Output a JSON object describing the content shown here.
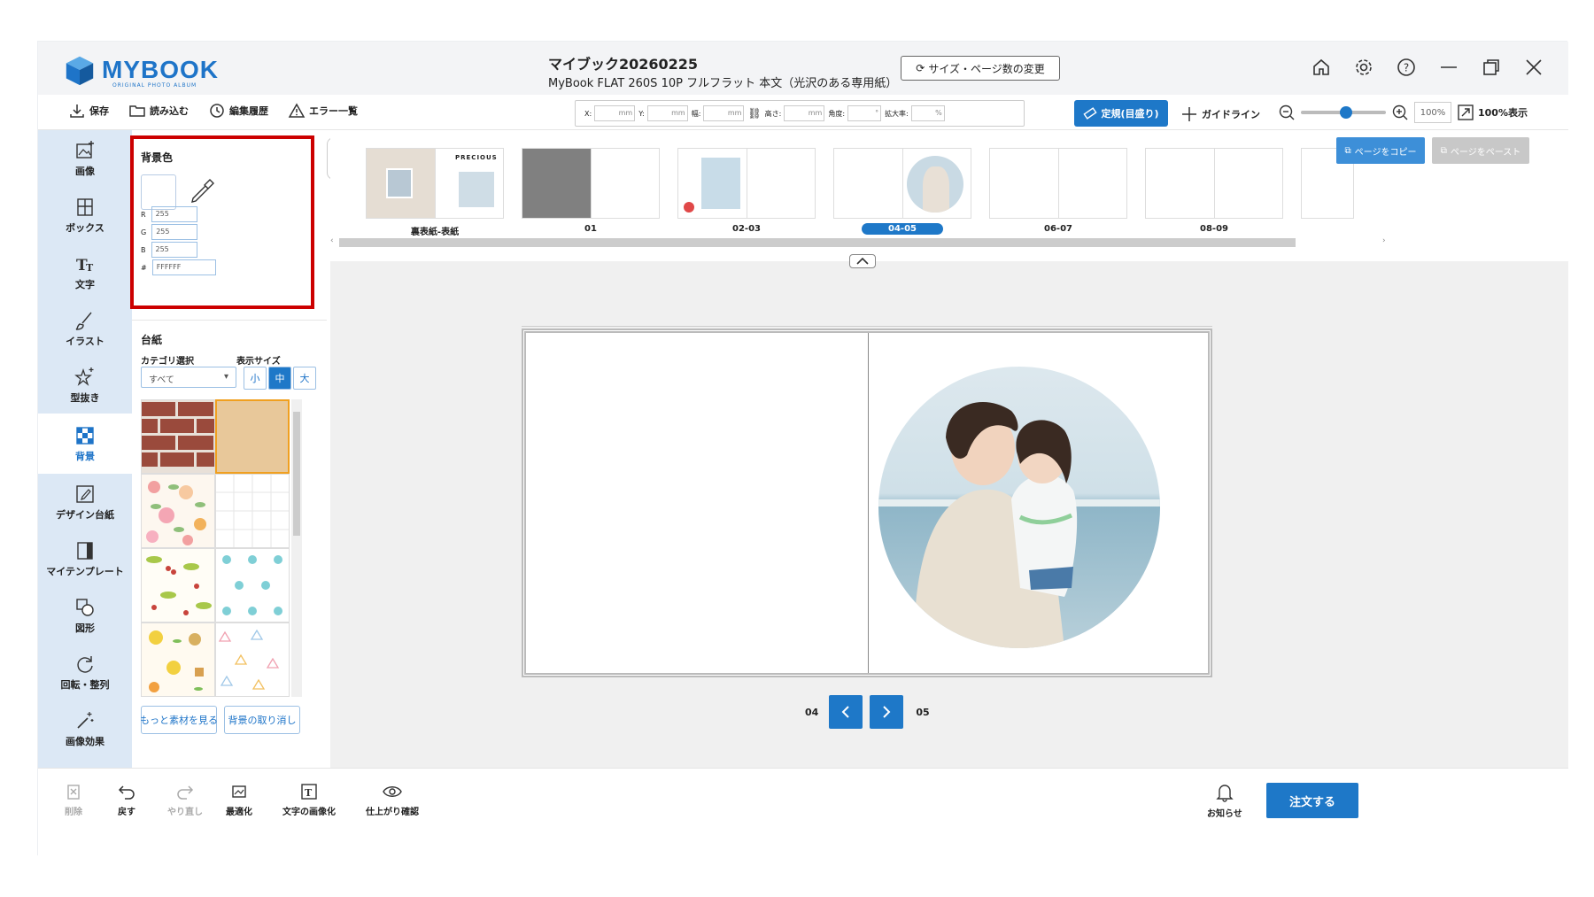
{
  "app": {
    "logo": "MYBOOK",
    "logo_sub": "ORIGINAL PHOTO ALBUM"
  },
  "document": {
    "title": "マイブック20260225",
    "subtitle": "MyBook FLAT 260S 10P フルフラット 本文（光沢のある専用紙）"
  },
  "header": {
    "size_button": "サイズ・ページ数の変更"
  },
  "toolbar": {
    "save": "保存",
    "load": "読み込む",
    "history": "編集履歴",
    "errors": "エラー一覧",
    "coords": [
      {
        "label": "X:",
        "unit": "mm"
      },
      {
        "label": "Y:",
        "unit": "mm"
      },
      {
        "label": "幅:",
        "unit": "mm"
      },
      {
        "label": "高さ:",
        "unit": "mm"
      },
      {
        "label": "角度:",
        "unit": "°"
      },
      {
        "label": "拡大率:",
        "unit": "%"
      }
    ],
    "ruler": "定規(目盛り)",
    "guide": "ガイドライン",
    "zoom": "100%",
    "fit": "100%表示"
  },
  "rail": [
    {
      "label": "画像",
      "icon": "image-add-icon"
    },
    {
      "label": "ボックス",
      "icon": "box-grid-icon"
    },
    {
      "label": "文字",
      "icon": "text-icon"
    },
    {
      "label": "イラスト",
      "icon": "brush-icon"
    },
    {
      "label": "型抜き",
      "icon": "star-cut-icon"
    },
    {
      "label": "背景",
      "icon": "checker-icon"
    },
    {
      "label": "デザイン台紙",
      "icon": "design-mount-icon"
    },
    {
      "label": "マイテンプレート",
      "icon": "template-icon"
    },
    {
      "label": "図形",
      "icon": "shapes-icon"
    },
    {
      "label": "回転・整列",
      "icon": "rotate-icon"
    },
    {
      "label": "画像効果",
      "icon": "magic-wand-icon"
    }
  ],
  "panel": {
    "bg_title": "背景色",
    "r_label": "R",
    "r": "255",
    "g_label": "G",
    "g": "255",
    "b_label": "B",
    "b": "255",
    "hex_label": "#",
    "hex": "FFFFFF",
    "mount_title": "台紙",
    "category_label": "カテゴリ選択",
    "category_value": "すべて",
    "size_label": "表示サイズ",
    "sizes": [
      "小",
      "中",
      "大"
    ],
    "more_button": "もっと素材を見る",
    "clear_button": "背景の取り消し"
  },
  "thumbnails": [
    {
      "label": "裏表紙-表紙",
      "text": "PRECIOUS"
    },
    {
      "label": "01"
    },
    {
      "label": "02-03"
    },
    {
      "label": "04-05",
      "current": true
    },
    {
      "label": "06-07"
    },
    {
      "label": "08-09"
    }
  ],
  "thumb_actions": {
    "copy": "ページをコピー",
    "paste": "ページをペースト"
  },
  "page_nav": {
    "left": "04",
    "right": "05"
  },
  "bottom": {
    "delete": "削除",
    "undo": "戻す",
    "redo": "やり直し",
    "optimize": "最適化",
    "text_to_image": "文字の画像化",
    "preview": "仕上がり確認",
    "notice": "お知らせ",
    "order": "注文する"
  },
  "colors": {
    "accent": "#1e78c8",
    "highlight": "#cc0000",
    "rail_bg": "#dce8f5"
  }
}
